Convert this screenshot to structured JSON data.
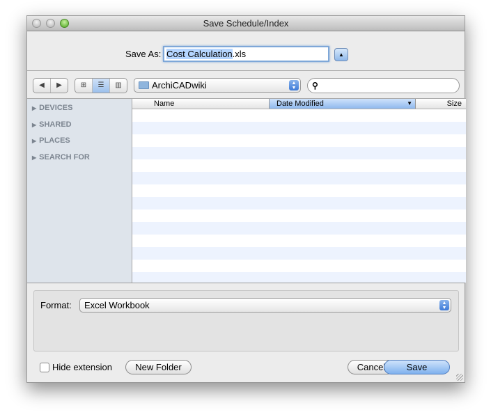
{
  "window": {
    "title": "Save Schedule/Index"
  },
  "save_as": {
    "label": "Save As:",
    "value_selected": "Cost Calculation",
    "value_ext": ".xls"
  },
  "toolbar": {
    "back": "◀",
    "forward": "▶",
    "view_icon": "⊞",
    "view_list": "☰",
    "view_column": "▥",
    "location": "ArchiCADwiki",
    "search_placeholder": ""
  },
  "sidebar": {
    "items": [
      {
        "label": "DEVICES"
      },
      {
        "label": "SHARED"
      },
      {
        "label": "PLACES"
      },
      {
        "label": "SEARCH FOR"
      }
    ]
  },
  "list": {
    "columns": [
      {
        "label": "Name"
      },
      {
        "label": "Date Modified"
      },
      {
        "label": "Size"
      }
    ],
    "sort_indicator": "▼"
  },
  "format": {
    "label": "Format:",
    "value": "Excel Workbook"
  },
  "footer": {
    "hide_extension": "Hide extension",
    "hide_extension_checked": false,
    "new_folder": "New Folder",
    "cancel": "Cancel",
    "save": "Save"
  }
}
